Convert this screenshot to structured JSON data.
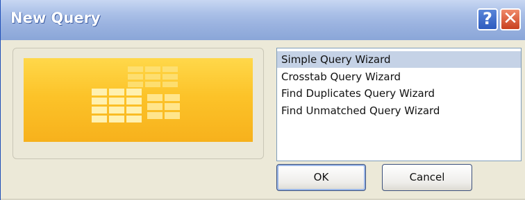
{
  "colors": {
    "titlebar": "#9bb3e0",
    "dialog_bg": "#ece9d8",
    "selection": "#c5d2e6",
    "close_red": "#d9502b",
    "help_blue": "#3f6fd1",
    "preview_yellow": "#fcc329"
  },
  "window": {
    "title": "New Query",
    "help_label": "?",
    "close_label": "✕",
    "help_icon": "question-mark-icon",
    "close_icon": "close-x-icon"
  },
  "preview": {
    "icon": "query-table-illustration"
  },
  "list": {
    "items": [
      {
        "label": "Simple Query Wizard",
        "selected": true
      },
      {
        "label": "Crosstab Query Wizard",
        "selected": false
      },
      {
        "label": "Find Duplicates Query Wizard",
        "selected": false
      },
      {
        "label": "Find Unmatched Query Wizard",
        "selected": false
      }
    ]
  },
  "buttons": {
    "ok": "OK",
    "cancel": "Cancel"
  }
}
